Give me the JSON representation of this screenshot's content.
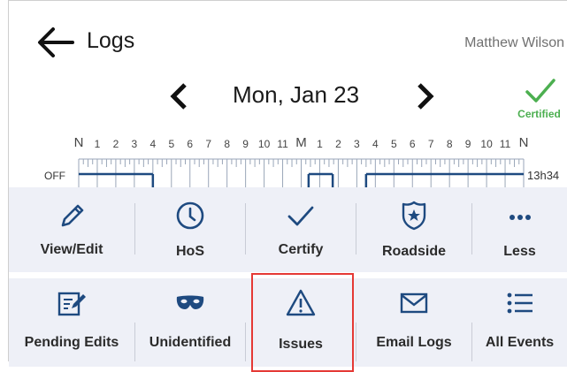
{
  "header": {
    "title": "Logs",
    "driver_name": "Matthew Wilson"
  },
  "date_nav": {
    "date": "Mon, Jan 23"
  },
  "certification": {
    "status": "Certified",
    "color": "#4caf50"
  },
  "timeline": {
    "hours": [
      "N",
      "1",
      "2",
      "3",
      "4",
      "5",
      "6",
      "7",
      "8",
      "9",
      "10",
      "11",
      "M",
      "1",
      "2",
      "3",
      "4",
      "5",
      "6",
      "7",
      "8",
      "9",
      "10",
      "11",
      "N"
    ],
    "status_label": "OFF",
    "total": "13h34"
  },
  "actions_row1": [
    {
      "label": "View/Edit",
      "icon": "pencil-icon"
    },
    {
      "label": "HoS",
      "icon": "clock-icon"
    },
    {
      "label": "Certify",
      "icon": "checkmark-icon"
    },
    {
      "label": "Roadside",
      "icon": "police-badge-icon"
    },
    {
      "label": "Less",
      "icon": "more-dots-icon"
    }
  ],
  "actions_row2": [
    {
      "label": "Pending Edits",
      "icon": "edit-document-icon"
    },
    {
      "label": "Unidentified",
      "icon": "mask-icon"
    },
    {
      "label": "Issues",
      "icon": "warning-icon"
    },
    {
      "label": "Email Logs",
      "icon": "envelope-icon"
    },
    {
      "label": "All Events",
      "icon": "list-icon"
    }
  ],
  "accent_color": "#1e4a80",
  "highlight_color": "#e53935"
}
